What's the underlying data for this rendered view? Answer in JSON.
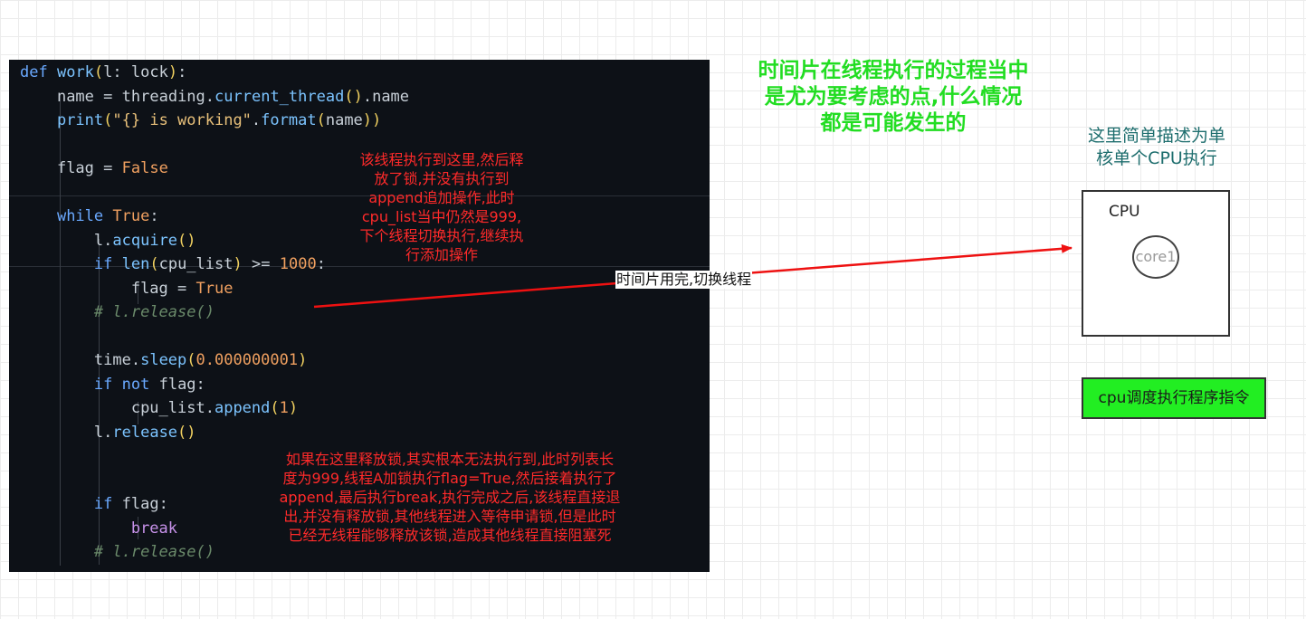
{
  "code": {
    "lines": [
      "def work(l: lock):",
      "    name = threading.current_thread().name",
      "    print(\"{} is working\".format(name))",
      "",
      "    flag = False",
      "",
      "    while True:",
      "        l.acquire()",
      "        if len(cpu_list) >= 1000:",
      "            flag = True",
      "        # l.release()",
      "",
      "        time.sleep(0.000000001)",
      "        if not flag:",
      "            cpu_list.append(1)",
      "        l.release()",
      "",
      "",
      "        if flag:",
      "            break",
      "        # l.release()"
    ]
  },
  "notes": {
    "lock_release_note": [
      "该线程执行到这里,然后释",
      "放了锁,并没有执行到",
      "append追加操作,此时",
      "cpu_list当中仍然是999,",
      "下个线程切换执行,继续执",
      "行添加操作"
    ],
    "deadlock_note": [
      "如果在这里释放锁,其实根本无法执行到,此时列表长",
      "度为999,线程A加锁执行flag=True,然后接着执行了",
      "append,最后执行break,执行完成之后,该线程直接退",
      "出,并没有释放锁,其他线程进入等待申请锁,但是此时",
      "已经无线程能够释放该锁,造成其他线程直接阻塞死"
    ],
    "time_slice_title": [
      "时间片在线程执行的过程当中",
      "是尤为要考虑的点,什么情况",
      "都是可能发生的"
    ],
    "single_core_note": [
      "这里简单描述为单",
      "核单个CPU执行"
    ],
    "arrow_label": "时间片用完,切换线程"
  },
  "cpu": {
    "label": "CPU",
    "core_label": "core1",
    "scheduler_label": "cpu调度执行程序指令"
  },
  "colors": {
    "code_background": "#0d1117",
    "note_red": "#ff2a2a",
    "title_green": "#22dd22",
    "note_teal": "#1e6e6e",
    "scheduler_fill": "#22ee22",
    "arrow": "#ee1111"
  }
}
